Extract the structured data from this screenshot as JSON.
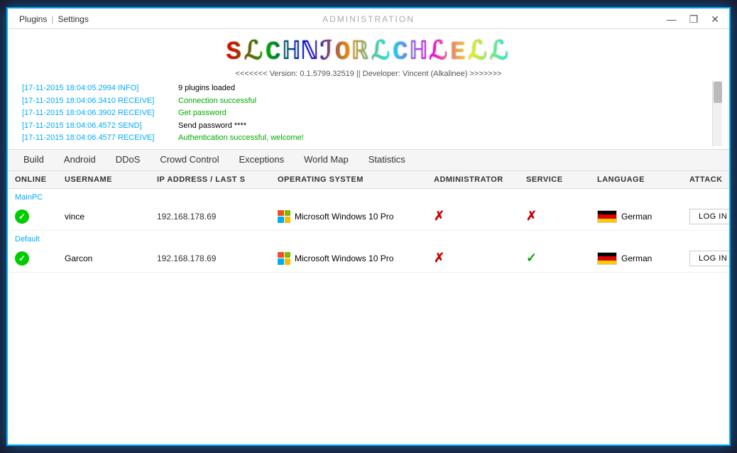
{
  "window": {
    "title": "ADMINISTRATION",
    "controls": {
      "minimize": "—",
      "maximize": "❐",
      "close": "✕"
    },
    "menu": {
      "plugins": "Plugins",
      "sep": "|",
      "settings": "Settings"
    }
  },
  "logo": {
    "text": "SLCHNIORLCHLELL",
    "display": "SℒCℍℕℐOℝℒCℍℒEℒℒ"
  },
  "version_line": "<<<<<<< Version: 0.1.5799.32519 || Developer: Vincent (Alkalinee) >>>>>>>",
  "log": {
    "plugins": "9 plugins loaded",
    "entries": [
      {
        "timestamp": "[17-11-2015 18:04:05.2994 INFO]",
        "message": "9 plugins loaded",
        "type": "normal"
      },
      {
        "timestamp": "[17-11-2015 18:04:06.3410 RECEIVE]",
        "message": "Connection successful",
        "type": "ok"
      },
      {
        "timestamp": "[17-11-2015 18:04:06.3902 RECEIVE]",
        "message": "Get password",
        "type": "ok"
      },
      {
        "timestamp": "[17-11-2015 18:04:06.4572 SEND]",
        "message": "Send password ****",
        "type": "normal"
      },
      {
        "timestamp": "[17-11-2015 18:04:06.4577 RECEIVE]",
        "message": "Authentication successful, welcome!",
        "type": "welcome"
      }
    ]
  },
  "nav": {
    "items": [
      "Build",
      "Android",
      "DDoS",
      "Crowd Control",
      "Exceptions",
      "World Map",
      "Statistics"
    ]
  },
  "table": {
    "headers": [
      "ONLINE",
      "USERNAME",
      "IP ADDRESS / LAST S",
      "OPERATING SYSTEM",
      "ADMINISTRATOR",
      "SERVICE",
      "LANGUAGE",
      "ATTACK"
    ],
    "groups": [
      {
        "label": "MainPC",
        "rows": [
          {
            "online": true,
            "username": "vince",
            "ip": "192.168.178.69",
            "os": "Microsoft Windows 10 Pro",
            "administrator": false,
            "service": false,
            "language": "German",
            "login_label": "LOG IN"
          }
        ]
      },
      {
        "label": "Default",
        "rows": [
          {
            "online": true,
            "username": "Garcon",
            "ip": "192.168.178.69",
            "os": "Microsoft Windows 10 Pro",
            "administrator": false,
            "service": true,
            "language": "German",
            "login_label": "LOG IN"
          }
        ]
      }
    ]
  }
}
